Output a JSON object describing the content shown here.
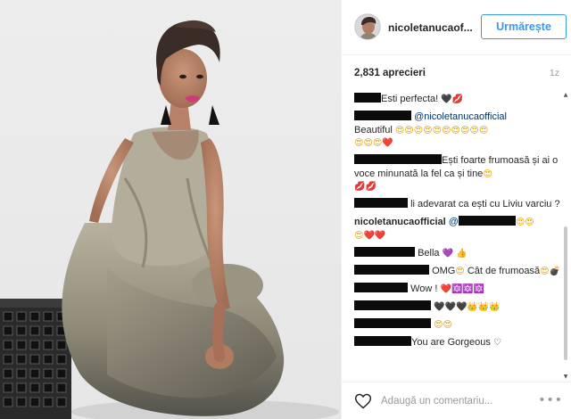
{
  "post": {
    "photo_alt": "portrait",
    "author": {
      "username": "nicoletanucaof...",
      "avatar_icon": "avatar-photo"
    },
    "follow_label": "Urmărește",
    "likes": "2,831 aprecieri",
    "time_ago": "1z",
    "comments": [
      {
        "text_a": "Esti perfecta! ",
        "emoji": [
          "🖤",
          "💋"
        ]
      },
      {
        "mention": "@nicoletanucaofficial",
        "text_a": "Beautiful ",
        "emoji": [
          "😍",
          "😍",
          "😍",
          "😍",
          "😍",
          "😍",
          "😍",
          "😍",
          "😍",
          "😍",
          "😍",
          "😍",
          "😍",
          "❤️"
        ]
      },
      {
        "text_a": "Ești foarte frumoasă și ai o voce minunată la fel ca și tine",
        "emoji": [
          "😍",
          "💋",
          "💋"
        ]
      },
      {
        "text_a": "li adevarat ca ești cu Liviu varciu ?"
      },
      {
        "author": "nicoletanucaofficial",
        "mention": "@",
        "emoji": [
          "😍",
          "😍",
          "😍",
          "❤️",
          "❤️"
        ]
      },
      {
        "text_a": "Bella ",
        "emoji": [
          "💜",
          "👍"
        ]
      },
      {
        "text_a": "OMG",
        "text_b": " Cât de frumoasă",
        "emoji_a": [
          "😍"
        ],
        "emoji_b": [
          "😍",
          "💣"
        ]
      },
      {
        "text_a": "Wow ! ",
        "emoji": [
          "❤️",
          "🔯",
          "🔯",
          "🔯"
        ]
      },
      {
        "emoji": [
          "🖤",
          "🖤",
          "🖤",
          "👑",
          "👑",
          "👑"
        ]
      },
      {
        "emoji": [
          "😍",
          "😍"
        ]
      },
      {
        "text_a": "You are Gorgeous ",
        "emoji": [
          "♡"
        ]
      }
    ],
    "comment_placeholder": "Adaugă un comentariu...",
    "more_label": "•••"
  },
  "colors": {
    "accent": "#3897f0",
    "text": "#262626",
    "muted": "#999999",
    "like_red": "#ed4956"
  }
}
